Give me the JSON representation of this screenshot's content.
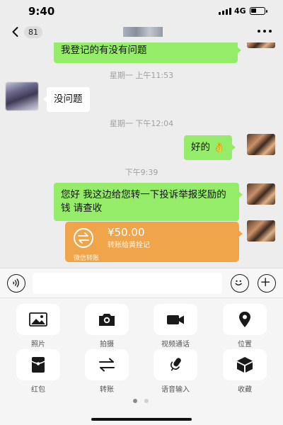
{
  "status_bar": {
    "time": "9:40",
    "network": "4G",
    "battery_icon": "battery-icon",
    "signal_icon": "signal-icon"
  },
  "nav": {
    "back_icon": "back-chevron-icon",
    "unread_count": "81",
    "more_icon": "more-icon"
  },
  "messages": [
    {
      "type": "text",
      "side": "right",
      "text": "我登记的有没有问题"
    },
    {
      "type": "time",
      "text": "星期一 上午11:53"
    },
    {
      "type": "text",
      "side": "left",
      "text": "没问题"
    },
    {
      "type": "time",
      "text": "星期一 下午12:04"
    },
    {
      "type": "text",
      "side": "right",
      "text": "好的 👌"
    },
    {
      "type": "time",
      "text": "下午9:39"
    },
    {
      "type": "text",
      "side": "right",
      "text": "您好 我这边给您转一下投诉举报奖励的钱 请查收"
    },
    {
      "type": "transfer",
      "side": "right",
      "amount": "¥50.00",
      "note": "转账给黄拴记",
      "footer": "微信转账"
    }
  ],
  "input_bar": {
    "voice_icon": "voice-icon",
    "emoji_icon": "emoji-icon",
    "plus_icon": "plus-icon",
    "value": ""
  },
  "panel": {
    "items": [
      {
        "label": "照片",
        "icon": "photo-icon"
      },
      {
        "label": "拍摄",
        "icon": "camera-icon"
      },
      {
        "label": "视频通话",
        "icon": "video-call-icon"
      },
      {
        "label": "位置",
        "icon": "location-icon"
      },
      {
        "label": "红包",
        "icon": "red-packet-icon"
      },
      {
        "label": "转账",
        "icon": "transfer-icon"
      },
      {
        "label": "语音输入",
        "icon": "voice-input-icon"
      },
      {
        "label": "收藏",
        "icon": "favorites-icon"
      }
    ],
    "page_count": 2,
    "active_page": 1
  },
  "colors": {
    "self_bubble": "#95ec69",
    "other_bubble": "#ffffff",
    "transfer": "#f0a54a",
    "background": "#ededed"
  }
}
